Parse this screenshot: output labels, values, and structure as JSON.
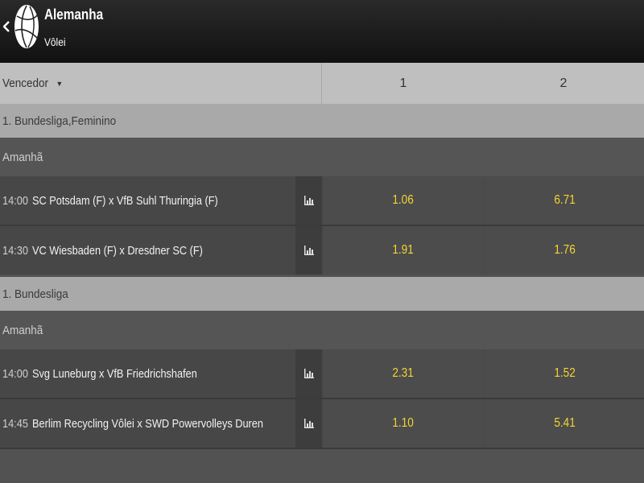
{
  "header": {
    "title": "Alemanha",
    "subtitle": "Vôlei",
    "logo_icon": "volleyball-icon",
    "back_icon": "chevron-left-icon"
  },
  "columns": {
    "market_label": "Vencedor",
    "col1": "1",
    "col2": "2"
  },
  "sections": [
    {
      "league": "1. Bundesliga,Feminino",
      "day": "Amanhã",
      "matches": [
        {
          "time": "14:00",
          "teams": "SC Potsdam (F) x VfB Suhl Thuringia (F)",
          "odd1": "1.06",
          "odd2": "6.71"
        },
        {
          "time": "14:30",
          "teams": "VC Wiesbaden (F) x Dresdner SC (F)",
          "odd1": "1.91",
          "odd2": "1.76"
        }
      ]
    },
    {
      "league": "1. Bundesliga",
      "day": "Amanhã",
      "matches": [
        {
          "time": "14:00",
          "teams": "Svg Luneburg x VfB Friedrichshafen",
          "odd1": "2.31",
          "odd2": "1.52"
        },
        {
          "time": "14:45",
          "teams": "Berlim Recycling Vôlei x SWD Powervolleys Duren",
          "odd1": "1.10",
          "odd2": "5.41"
        }
      ]
    }
  ],
  "colors": {
    "odds": "#f5d533",
    "header_bg": "#1a1a1a",
    "league_bg": "#a9a9a9",
    "column_header_bg": "#bfbfbf"
  }
}
